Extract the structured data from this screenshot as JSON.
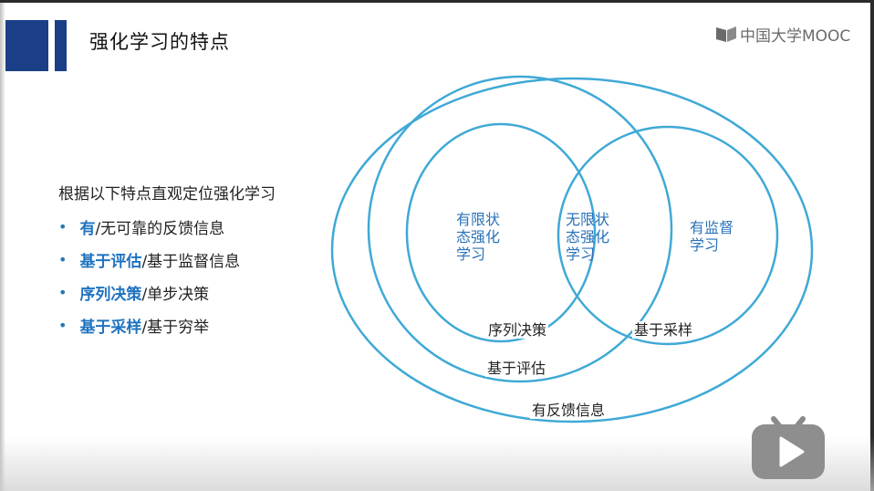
{
  "slide": {
    "title": "强化学习的特点",
    "logo_text": "中国大学MOOC",
    "intro": "根据以下特点直观定位强化学习",
    "bullets": [
      {
        "highlight": "有",
        "rest": "/无可靠的反馈信息"
      },
      {
        "highlight": "基于评估",
        "rest": "/基于监督信息"
      },
      {
        "highlight": "序列决策",
        "rest": "/单步决策"
      },
      {
        "highlight": "基于采样",
        "rest": "/基于穷举"
      }
    ]
  },
  "diagram": {
    "region_labels": {
      "finite": [
        "有限状",
        "态强化",
        "学习"
      ],
      "infinite": [
        "无限状",
        "态强化",
        "学习"
      ],
      "supervised": [
        "有监督",
        "学习"
      ]
    },
    "circle_labels": {
      "sequential": "序列决策",
      "sampling": "基于采样",
      "evaluation": "基于评估",
      "feedback": "有反馈信息"
    },
    "colors": {
      "circle": "#3fa9d6",
      "accent_text": "#2a72b9",
      "header_block": "#1b3f86"
    }
  },
  "player": {
    "icon": "play-icon"
  }
}
